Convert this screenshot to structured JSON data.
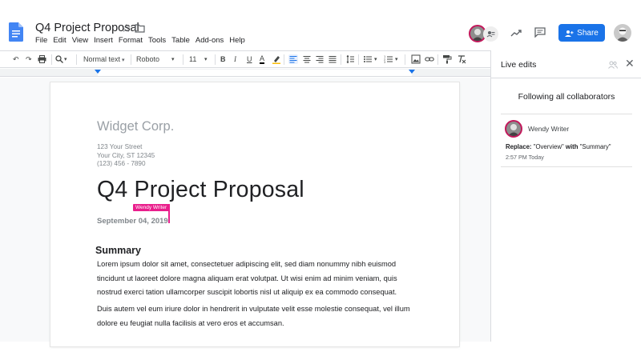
{
  "document": {
    "title": "Q4 Project Proposal",
    "menu": [
      "File",
      "Edit",
      "View",
      "Insert",
      "Format",
      "Tools",
      "Table",
      "Add-ons",
      "Help"
    ]
  },
  "header": {
    "share_label": "Share",
    "brand_color": "#1a73e8",
    "collaborator_color": "#e91e8c"
  },
  "toolbar": {
    "zoom_icon": "zoom-icon",
    "style_value": "Normal text",
    "font_value": "Roboto",
    "size_value": "11",
    "bold": "B",
    "italic": "I",
    "underline": "U",
    "text_color": "A"
  },
  "page": {
    "company": "Widget Corp.",
    "address_line1": "123 Your Street",
    "address_line2": "Your City, ST 12345",
    "phone": "(123) 456 - 7890",
    "heading": "Q4 Project Proposal",
    "cursor_label": "Wendy Writer",
    "date": "September 04, 2019",
    "section_title": "Summary",
    "para1": "Lorem ipsum dolor sit amet, consectetuer adipiscing elit, sed diam nonummy nibh euismod tincidunt ut laoreet dolore magna aliquam erat volutpat. Ut wisi enim ad minim veniam, quis nostrud exerci tation ullamcorper suscipit lobortis nisl ut aliquip ex ea commodo consequat.",
    "para2": "Duis autem vel eum iriure dolor in hendrerit in vulputate velit esse molestie consequat, vel illum dolore eu feugiat nulla facilisis at vero eros et accumsan."
  },
  "panel": {
    "title": "Live edits",
    "following": "Following all collaborators",
    "edit": {
      "user": "Wendy Writer",
      "replace_label": "Replace:",
      "old_text": "\"Overview\"",
      "with_label": "with",
      "new_text": "\"Summary\"",
      "time": "2:57 PM Today"
    }
  }
}
